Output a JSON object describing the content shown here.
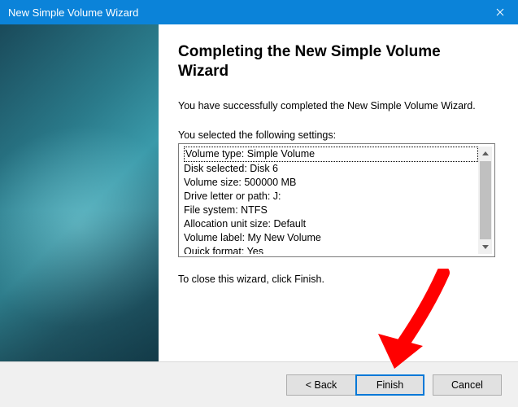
{
  "window": {
    "title": "New Simple Volume Wizard"
  },
  "heading": "Completing the New Simple Volume Wizard",
  "intro": "You have successfully completed the New Simple Volume Wizard.",
  "settings_label": "You selected the following settings:",
  "settings": [
    "Volume type: Simple Volume",
    "Disk selected: Disk 6",
    "Volume size: 500000 MB",
    "Drive letter or path: J:",
    "File system: NTFS",
    "Allocation unit size: Default",
    "Volume label: My New Volume",
    "Quick format: Yes"
  ],
  "close_msg": "To close this wizard, click Finish.",
  "buttons": {
    "back": "< Back",
    "finish": "Finish",
    "cancel": "Cancel"
  }
}
